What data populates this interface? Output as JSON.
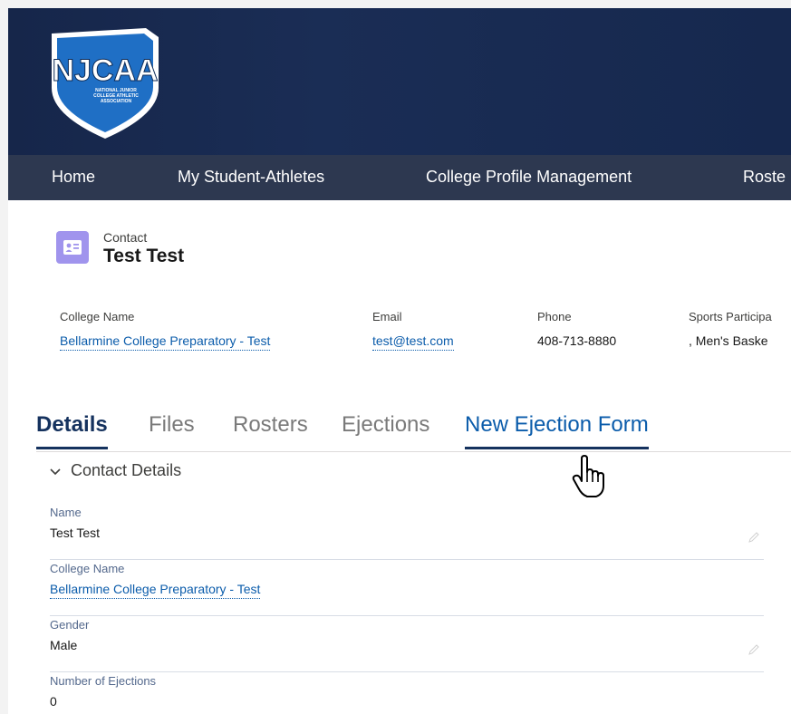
{
  "brand": {
    "logo_text": "NJCAA",
    "logo_subtitle": "NATIONAL JUNIOR COLLEGE ATHLETIC ASSOCIATION"
  },
  "nav": {
    "items": [
      {
        "label": "Home"
      },
      {
        "label": "My Student-Athletes"
      },
      {
        "label": "College Profile Management"
      },
      {
        "label": "Roste"
      }
    ]
  },
  "record": {
    "type": "Contact",
    "name": "Test Test"
  },
  "highlights": {
    "college_name_label": "College Name",
    "college_name_value": "Bellarmine College Preparatory - Test",
    "email_label": "Email",
    "email_value": "test@test.com",
    "phone_label": "Phone",
    "phone_value": "408-713-8880",
    "sports_label": "Sports Participa",
    "sports_value": ", Men's Baske"
  },
  "tabs": [
    {
      "label": "Details",
      "state": "active"
    },
    {
      "label": "Files",
      "state": "normal"
    },
    {
      "label": "Rosters",
      "state": "normal"
    },
    {
      "label": "Ejections",
      "state": "normal"
    },
    {
      "label": "New Ejection Form",
      "state": "hover"
    }
  ],
  "section": {
    "title": "Contact Details",
    "fields": [
      {
        "label": "Name",
        "value": "Test Test",
        "link": false,
        "editable": true
      },
      {
        "label": "College Name",
        "value": "Bellarmine College Preparatory - Test",
        "link": true,
        "editable": false
      },
      {
        "label": "Gender",
        "value": "Male",
        "link": false,
        "editable": true
      },
      {
        "label": "Number of Ejections",
        "value": "0",
        "link": false,
        "editable": false
      }
    ]
  },
  "colors": {
    "banner": "#16264a",
    "navbar": "#2d3850",
    "accent": "#15325e",
    "link": "#0b5cab",
    "contact_icon": "#a094ed"
  },
  "icons": {
    "logo": "njcaa-shield-logo",
    "contact": "contact-card-icon",
    "section_toggle": "chevron-down-icon",
    "edit": "pencil-icon",
    "pointer": "hand-pointer-cursor-icon"
  }
}
